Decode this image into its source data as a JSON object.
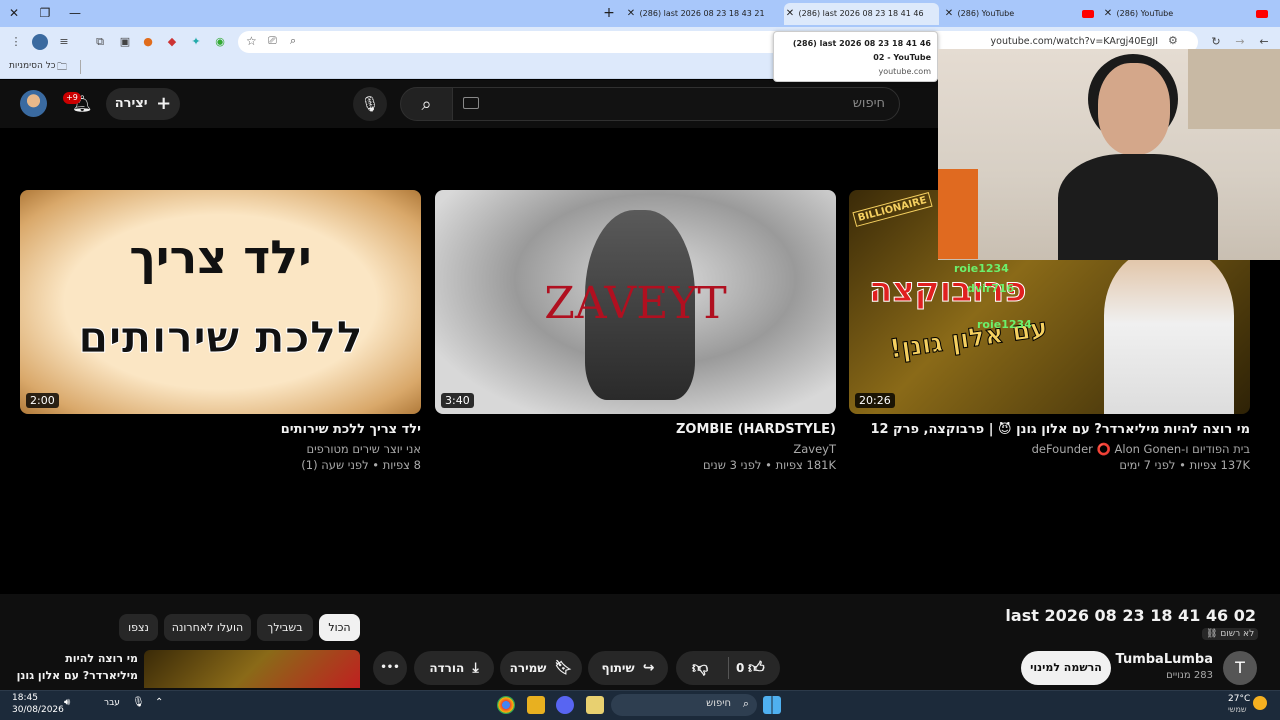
{
  "browser": {
    "tabs": [
      {
        "title": "(286) YouTube"
      },
      {
        "title": "(286) YouTube"
      },
      {
        "title": "(286) last 2026 08 23 18 41 46"
      },
      {
        "title": "(286) last 2026 08 23 18 43 21"
      }
    ],
    "new_tab": "+",
    "url": "youtube.com/watch?v=KArgj40EgJI",
    "bookmarks_label": "כל הסימניות",
    "tooltip": {
      "title": "(286) last 2026 08 23 18 41 46 02 - YouTube",
      "host": "youtube.com"
    }
  },
  "youtube": {
    "search_placeholder": "חיפוש",
    "create_label": "יצירה",
    "notifications_badge": "+9"
  },
  "videos": [
    {
      "title": "ילד צריך ללכת שירותים",
      "channel": "אני יוצר שירים מטורפים",
      "meta": "8 צפיות • לפני שעה (1)",
      "duration": "2:00",
      "thumb_text_line1": "ילד צריך",
      "thumb_text_line2": "ללכת שירותים"
    },
    {
      "title": "ZOMBIE (HARDSTYLE)",
      "channel": "ZaveyT",
      "meta": "181K צפיות • לפני 3 שנים",
      "duration": "3:40",
      "thumb_text_line1": "ZAVEYT"
    },
    {
      "title": "מי רוצה להיות מיליארדר? עם אלון גונן 😈 | פרבוקצה, פרק 12",
      "channel": "בית הפודיום ו-deFounder ⭕ Alon Gonen",
      "meta": "137K צפיות • לפני 7 ימים",
      "duration": "20:26",
      "thumb_text_line1": "פרובוקצה",
      "thumb_text_line2": "עם אלון גונן!",
      "thumb_badge": "BILLIONAIRE"
    }
  ],
  "chat_overlay": [
    "roie1234",
    "dvir716",
    "roie1234"
  ],
  "watch": {
    "title": "last 2026 08 23 18 41 46 02",
    "privacy": "לא רשום",
    "channel_name": "TumbaLumba",
    "subscribers": "283 מנויים",
    "channel_initial": "T",
    "subscribe_label": "הרשמה למינוי",
    "like_count": "0",
    "share_label": "שיתוף",
    "save_label": "שמירה",
    "download_label": "הורדה",
    "more_label": "•••",
    "chips": [
      "הכול",
      "בשבילך",
      "הועלו לאחרונה",
      "נצפו"
    ],
    "upnext_title": "מי רוצה להיות מיליארדר? עם אלון גונן 😈 |"
  },
  "taskbar": {
    "time": "18:45",
    "date": "30/08/2026",
    "lang": "עבר",
    "search_label": "חיפוש",
    "weather_temp": "27°C",
    "weather_desc": "שמשי"
  }
}
